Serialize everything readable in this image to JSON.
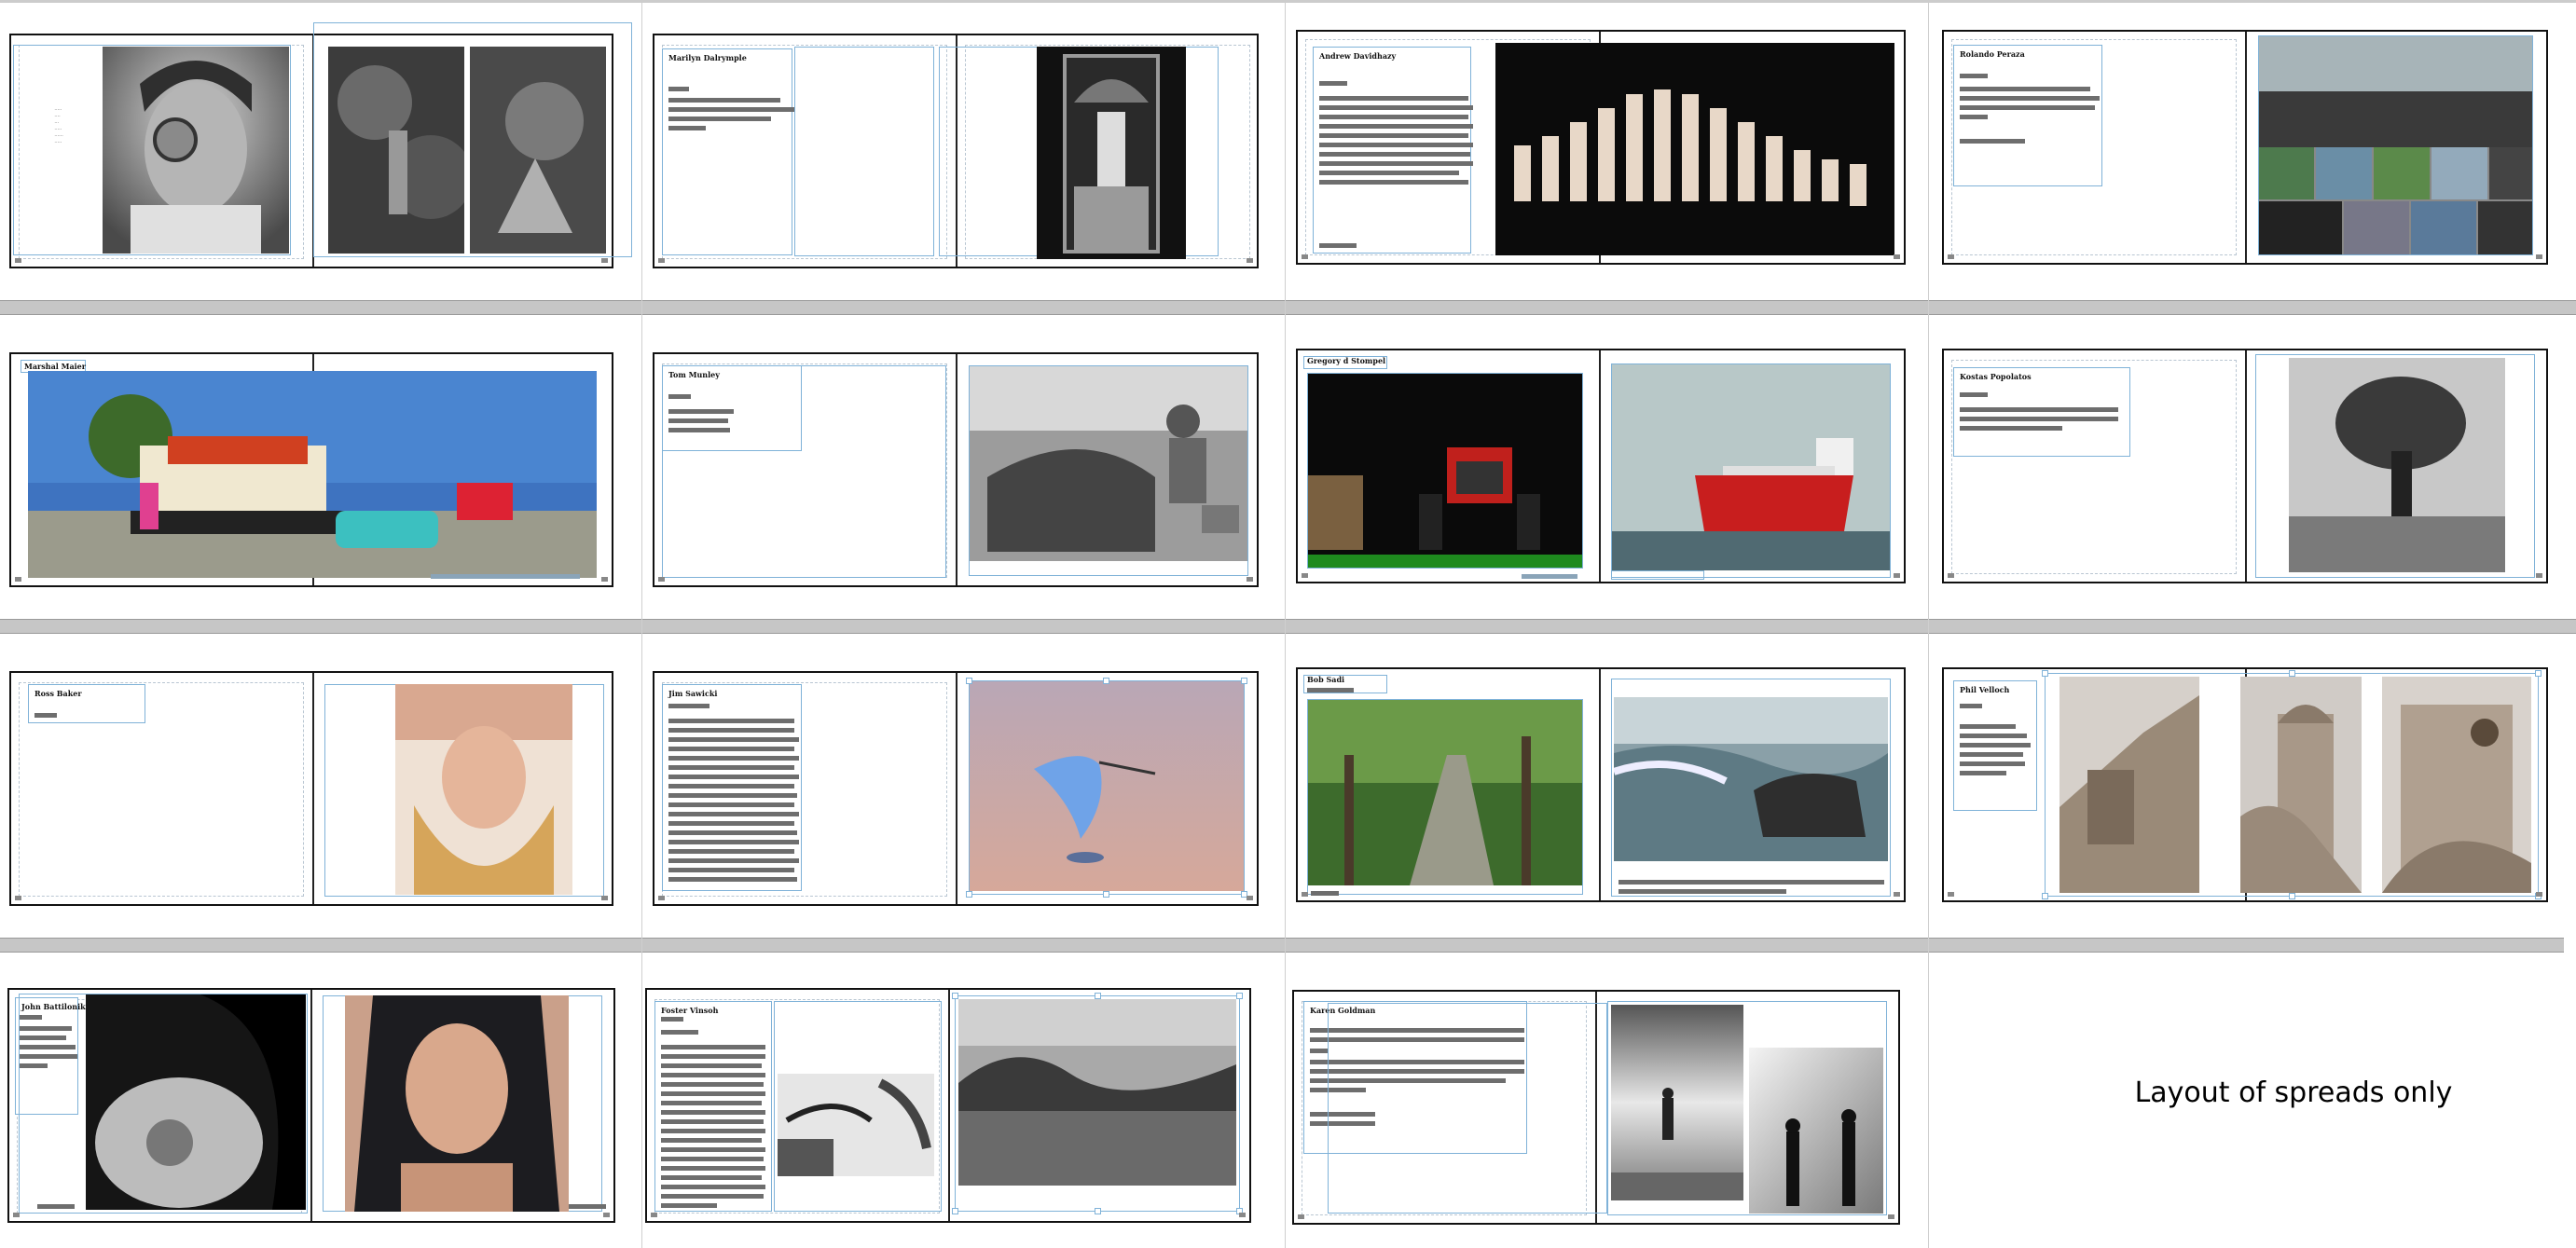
{
  "note": "Layout of spreads only",
  "spreads": [
    {
      "author": ""
    },
    {
      "author": "Marilyn Dalrymple"
    },
    {
      "author": "Andrew Davidhazy"
    },
    {
      "author": "Rolando Peraza"
    },
    {
      "author": "Marshal Maier"
    },
    {
      "author": "Tom Munley"
    },
    {
      "author": "Gregory d Stompel"
    },
    {
      "author": "Kostas Popolatos"
    },
    {
      "author": "Ross Baker"
    },
    {
      "author": "Jim Sawicki"
    },
    {
      "author": "Bob Sadi"
    },
    {
      "author": "Phil Velloch"
    },
    {
      "author": "John Battilonik"
    },
    {
      "author": "Foster Vinsoh"
    },
    {
      "author": "Karen Goldman"
    }
  ]
}
